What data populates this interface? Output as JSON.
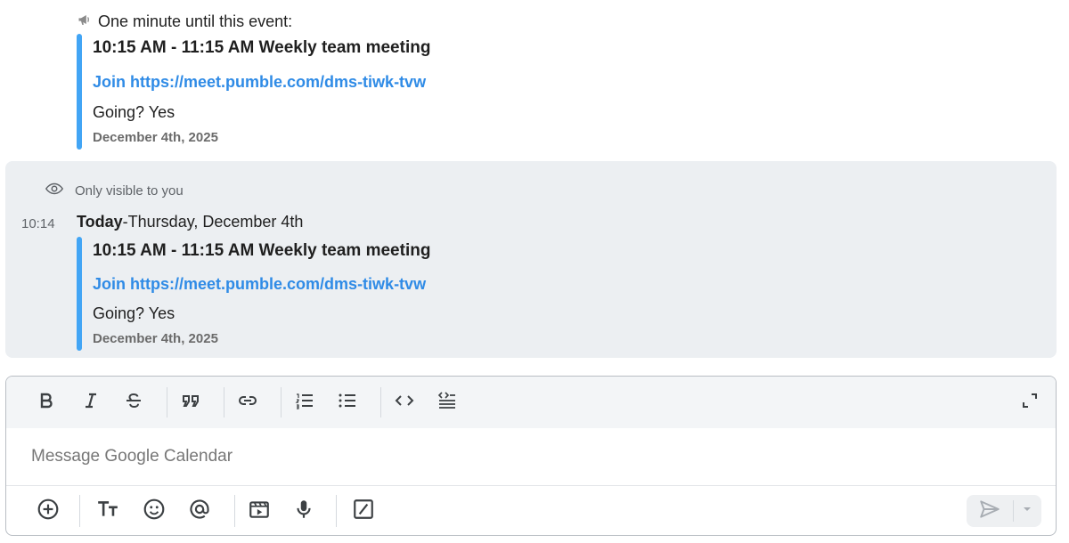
{
  "reminder": {
    "text": "One minute until this event:",
    "icon": "megaphone-icon",
    "event": {
      "title": "10:15 AM - 11:15 AM Weekly team meeting",
      "join_label": "Join",
      "join_url": "https://meet.pumble.com/dms-tiwk-tvw",
      "going": "Going? Yes",
      "date": "December 4th, 2025"
    }
  },
  "ephemeral": {
    "visibility_note": "Only visible to you",
    "timestamp": "10:14",
    "day_bold": "Today",
    "day_rest": "-Thursday, December 4th",
    "event": {
      "title": "10:15 AM - 11:15 AM Weekly team meeting",
      "join_label": "Join",
      "join_url": "https://meet.pumble.com/dms-tiwk-tvw",
      "going": "Going? Yes",
      "date": "December 4th, 2025"
    }
  },
  "composer": {
    "placeholder": "Message Google Calendar",
    "toolbar": [
      "bold",
      "italic",
      "strikethrough",
      "quote",
      "link",
      "ordered-list",
      "bulleted-list",
      "code",
      "code-block",
      "expand"
    ],
    "bottom_actions": [
      "add",
      "formatting",
      "emoji",
      "mention",
      "gif",
      "voice",
      "slash-command",
      "send"
    ]
  },
  "colors": {
    "accent": "#42a5f5",
    "link": "#2f8be6",
    "ephemeral_bg": "#eceff2"
  }
}
